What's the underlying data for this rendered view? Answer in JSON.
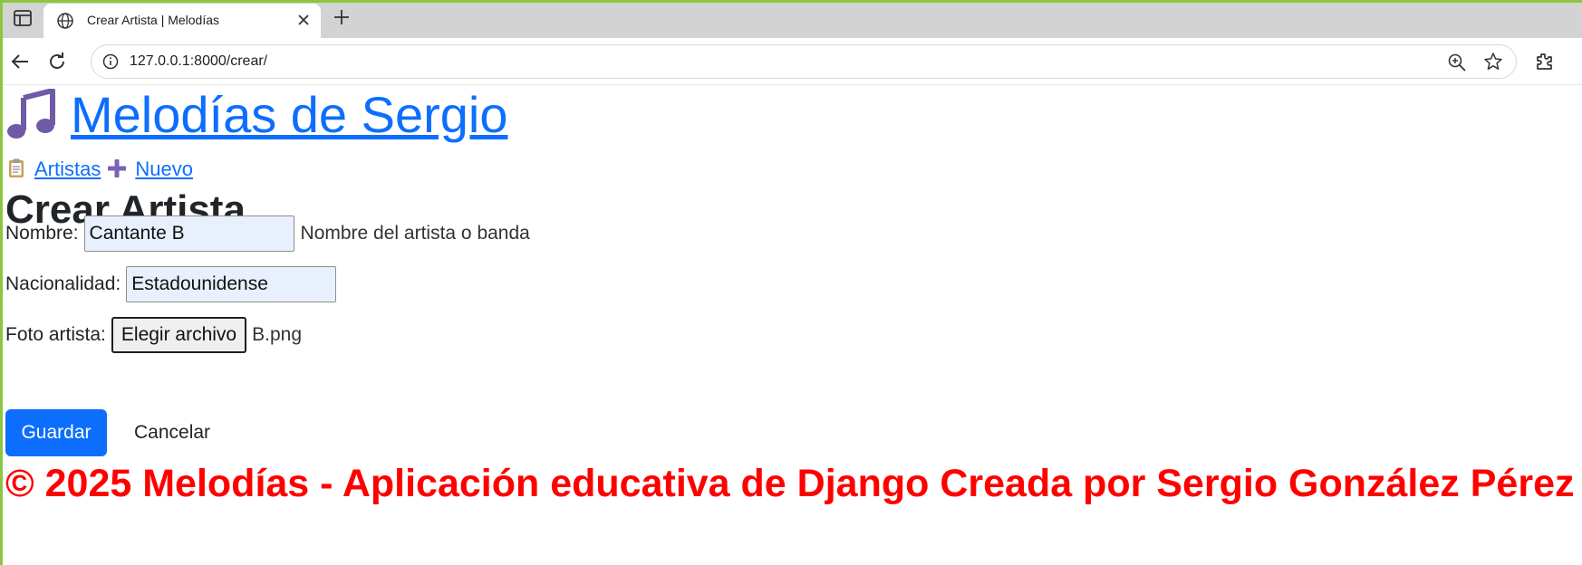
{
  "browser": {
    "tab_title": "Crear Artista | Melodías",
    "url": "127.0.0.1:8000/crear/"
  },
  "site": {
    "title": "Melodías de Sergio",
    "icon": "music-notes-icon"
  },
  "nav": {
    "items": [
      {
        "label": "Artistas",
        "icon": "clipboard-icon"
      },
      {
        "label": "Nuevo",
        "icon": "plus-icon"
      }
    ]
  },
  "page": {
    "heading": "Crear Artista"
  },
  "form": {
    "nombre": {
      "label": "Nombre:",
      "value": "Cantante B",
      "help": "Nombre del artista o banda"
    },
    "nacionalidad": {
      "label": "Nacionalidad:",
      "value": "Estadounidense"
    },
    "foto": {
      "label": "Foto artista:",
      "button": "Elegir archivo",
      "filename": "B.png"
    },
    "save_label": "Guardar",
    "cancel_label": "Cancelar"
  },
  "footer": {
    "text": "© 2025 Melodías - Aplicación educativa de Django Creada por Sergio González Pérez"
  },
  "colors": {
    "link": "#0d6efd",
    "primary_button": "#0d6efd",
    "footer_text": "#ff0000",
    "autofill_field": "#e8f0fe"
  }
}
